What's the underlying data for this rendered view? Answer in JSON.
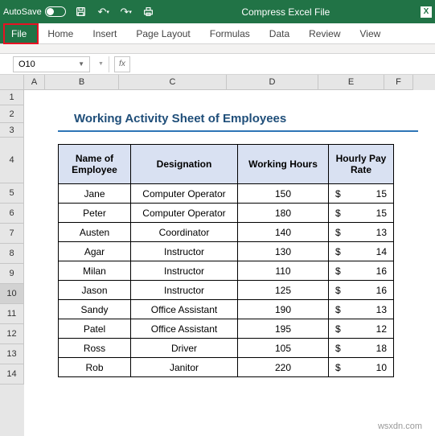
{
  "title_bar": {
    "autosave": "AutoSave",
    "doc_name": "Compress Excel File"
  },
  "menu": {
    "file": "File",
    "home": "Home",
    "insert": "Insert",
    "page_layout": "Page Layout",
    "formulas": "Formulas",
    "data": "Data",
    "review": "Review",
    "view": "View"
  },
  "name_box": "O10",
  "fx_label": "fx",
  "col_labels": {
    "A": "A",
    "B": "B",
    "C": "C",
    "D": "D",
    "E": "E",
    "F": "F"
  },
  "row_labels": [
    "1",
    "2",
    "3",
    "4",
    "5",
    "6",
    "7",
    "8",
    "9",
    "10",
    "11",
    "12",
    "13",
    "14"
  ],
  "sheet_title": "Working Activity Sheet of Employees",
  "headers": {
    "name": "Name of Employee",
    "designation": "Designation",
    "hours": "Working Hours",
    "rate": "Hourly Pay Rate"
  },
  "rows": [
    {
      "name": "Jane",
      "designation": "Computer Operator",
      "hours": "150",
      "cur": "$",
      "rate": "15"
    },
    {
      "name": "Peter",
      "designation": "Computer Operator",
      "hours": "180",
      "cur": "$",
      "rate": "15"
    },
    {
      "name": "Austen",
      "designation": "Coordinator",
      "hours": "140",
      "cur": "$",
      "rate": "13"
    },
    {
      "name": "Agar",
      "designation": "Instructor",
      "hours": "130",
      "cur": "$",
      "rate": "14"
    },
    {
      "name": "Milan",
      "designation": "Instructor",
      "hours": "110",
      "cur": "$",
      "rate": "16"
    },
    {
      "name": "Jason",
      "designation": "Instructor",
      "hours": "125",
      "cur": "$",
      "rate": "16"
    },
    {
      "name": "Sandy",
      "designation": "Office Assistant",
      "hours": "190",
      "cur": "$",
      "rate": "13"
    },
    {
      "name": "Patel",
      "designation": "Office Assistant",
      "hours": "195",
      "cur": "$",
      "rate": "12"
    },
    {
      "name": "Ross",
      "designation": "Driver",
      "hours": "105",
      "cur": "$",
      "rate": "18"
    },
    {
      "name": "Rob",
      "designation": "Janitor",
      "hours": "220",
      "cur": "$",
      "rate": "10"
    }
  ],
  "col_widths": {
    "A": 26,
    "B": 92,
    "C": 134,
    "D": 114,
    "E": 82,
    "F": 36
  },
  "watermark": "wsxdn.com"
}
